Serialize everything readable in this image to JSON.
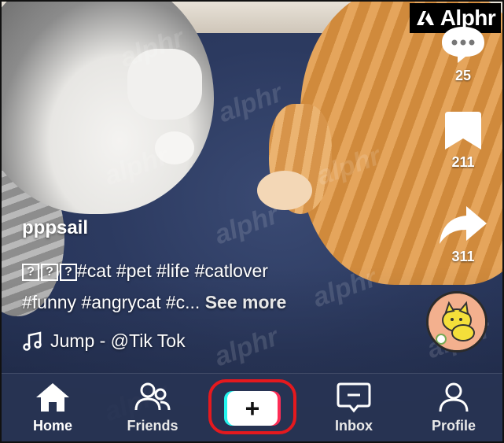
{
  "brand": {
    "logo_text": "Alphr"
  },
  "watermark": "alphr",
  "actions": {
    "comments_count": "25",
    "saves_count": "211",
    "shares_count": "311"
  },
  "post": {
    "username": "pppsail",
    "caption_hashtags_line1": "#cat #pet #life #catlover",
    "caption_line2": "#funny #angrycat #c...",
    "see_more": "See more",
    "emoji_placeholders": [
      "?",
      "?",
      "?"
    ],
    "sound": "Jump - @Tik Tok"
  },
  "tabbar": {
    "items": [
      {
        "label": "Home",
        "icon": "home-icon",
        "active": true
      },
      {
        "label": "Friends",
        "icon": "friends-icon",
        "active": false
      },
      {
        "label": "Inbox",
        "icon": "inbox-icon",
        "active": false
      },
      {
        "label": "Profile",
        "icon": "profile-icon",
        "active": false
      }
    ],
    "create_label": "+"
  },
  "colors": {
    "highlight": "#e5191e",
    "tiktok_cyan": "#25f4ee",
    "tiktok_red": "#fe2c55"
  }
}
